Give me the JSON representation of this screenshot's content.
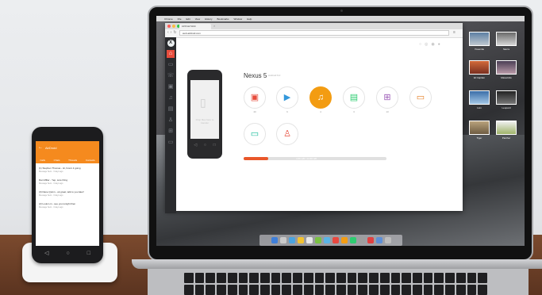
{
  "phone": {
    "app_title": "AirDroid",
    "tabs": [
      "Calls",
      "Chats",
      "Threads",
      "Contacts"
    ],
    "messages": [
      {
        "title": "(1) Stephen Thomas - Hi, how's it going",
        "sub": "Message Sent - 3 days ago"
      },
      {
        "title": "Dan Miller - Yep, sure thing",
        "sub": "Message Sent - 3 days ago"
      },
      {
        "title": "(3) Dane Quinn - ok great, talk to you later!",
        "sub": "Message Sent - 3 days ago"
      },
      {
        "title": "(2) Louis Lin - see you tonight then",
        "sub": "Message Sent - 3 days ago"
      }
    ]
  },
  "mac": {
    "menubar": [
      "Chrome",
      "File",
      "Edit",
      "View",
      "History",
      "Bookmarks",
      "Window",
      "Help"
    ],
    "desktop_labels": [
      "Yosemite",
      "Sierra",
      "El Capitan",
      "Mavericks",
      "Lion",
      "Leopard",
      "Tiger",
      "Panther"
    ]
  },
  "browser": {
    "tab_title": "AirDroid Web",
    "url": "web.airdroid.com"
  },
  "device": {
    "name": "Nexus 5",
    "subtitle": "Android 6.0",
    "screen_hint": "Drop files here to transfer",
    "storage_text": "4.56 GB / 12.86 GB",
    "storage_fraction": 0.17
  },
  "tiles": [
    {
      "name": "photos",
      "icon": "image-icon",
      "count": "40",
      "color": "#e74c3c",
      "glyph": "▣"
    },
    {
      "name": "videos",
      "icon": "video-icon",
      "count": "6",
      "color": "#3498db",
      "glyph": "▶"
    },
    {
      "name": "music",
      "icon": "music-icon",
      "count": "4",
      "color": "#ffffff",
      "glyph": "♫"
    },
    {
      "name": "documents",
      "icon": "document-icon",
      "count": "3",
      "color": "#2ecc71",
      "glyph": "▤"
    },
    {
      "name": "apps",
      "icon": "apps-grid-icon",
      "count": "13",
      "color": "#9b59b6",
      "glyph": "⊞"
    },
    {
      "name": "files",
      "icon": "folder-icon",
      "count": "",
      "color": "#e67e22",
      "glyph": "▭"
    },
    {
      "name": "messages",
      "icon": "message-icon",
      "count": "",
      "color": "#1abc9c",
      "glyph": "▭"
    },
    {
      "name": "contacts",
      "icon": "contact-icon",
      "count": "",
      "color": "#e74c3c",
      "glyph": "♙"
    }
  ],
  "colors": {
    "accent_orange": "#f39c12",
    "phone_header": "#f58a1e",
    "sidebar_active": "#e74c3c",
    "storage_fill": "#e9572a"
  }
}
